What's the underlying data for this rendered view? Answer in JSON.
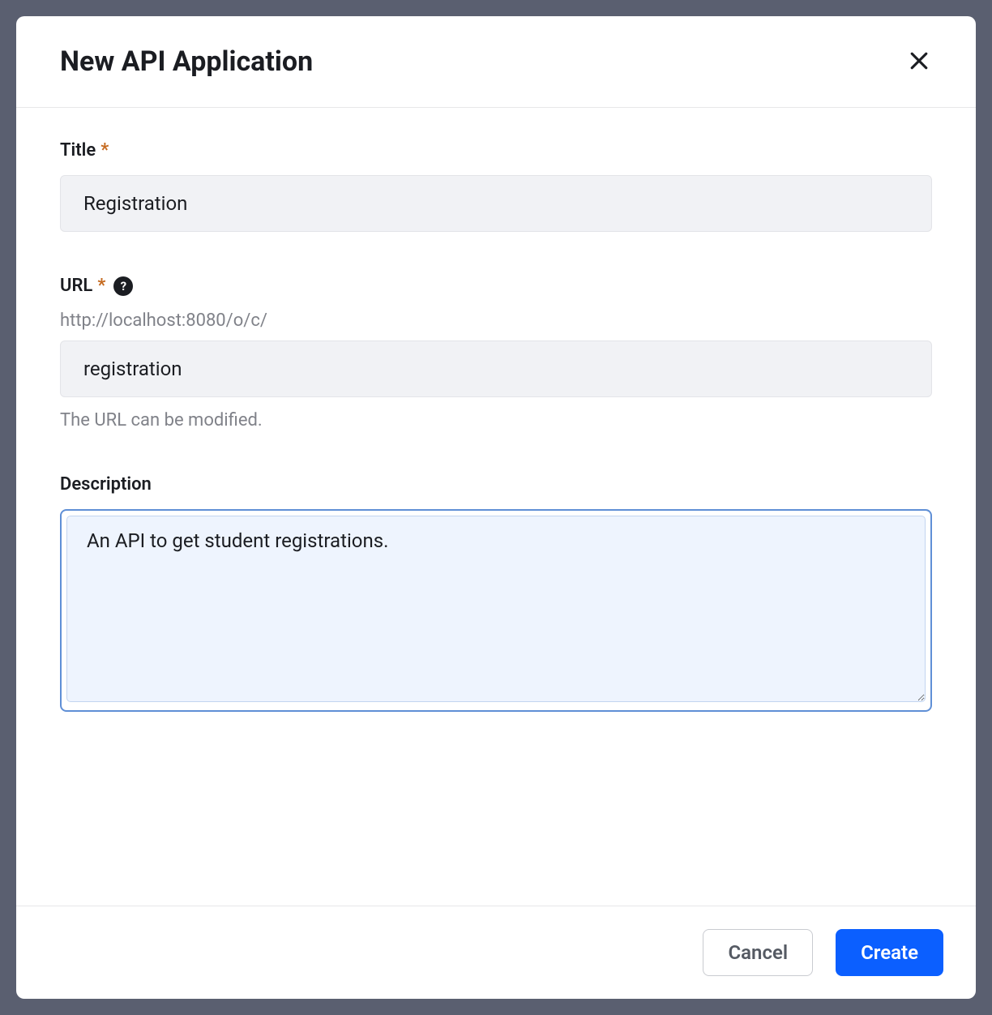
{
  "modal": {
    "title": "New API Application"
  },
  "fields": {
    "title": {
      "label": "Title",
      "value": "Registration"
    },
    "url": {
      "label": "URL",
      "hint": "http://localhost:8080/o/c/",
      "value": "registration",
      "helpText": "The URL can be modified."
    },
    "description": {
      "label": "Description",
      "value": "An API to get student registrations."
    }
  },
  "footer": {
    "cancel": "Cancel",
    "create": "Create"
  }
}
